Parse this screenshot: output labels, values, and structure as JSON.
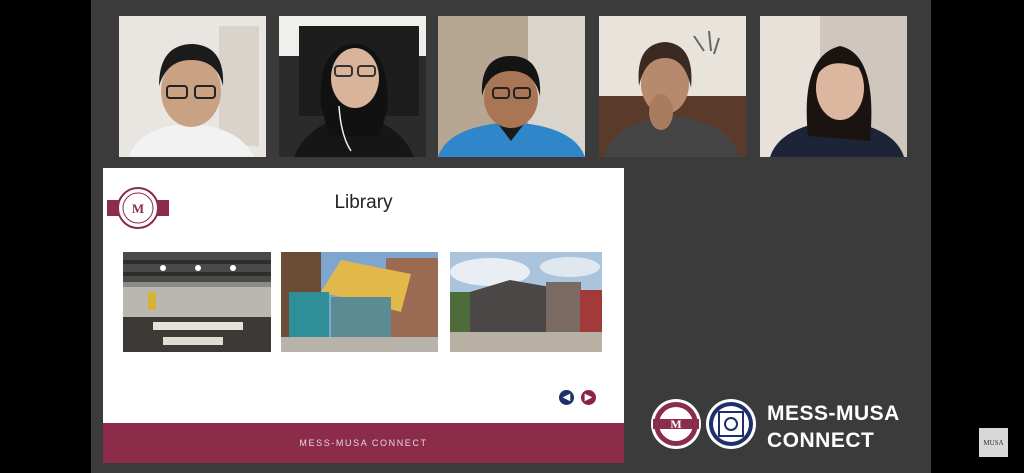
{
  "participants": [
    {
      "name": "",
      "colors": {
        "bg": "#e9e6e1",
        "skin": "#c9a183",
        "hair": "#1b1b1b",
        "shirt": "#f2f2f2"
      }
    },
    {
      "name": "",
      "colors": {
        "bg": "#2b2b2b",
        "skin": "#d9b39a",
        "hair": "#111111",
        "shirt": "#161616"
      }
    },
    {
      "name": "",
      "colors": {
        "bg": "#b6a692",
        "skin": "#a87555",
        "hair": "#141414",
        "shirt": "#2f86c9"
      }
    },
    {
      "name": "",
      "colors": {
        "bg": "#e8e4dc",
        "skin": "#b78a6d",
        "hair": "#3a2a21",
        "shirt": "#454545"
      }
    },
    {
      "name": "",
      "colors": {
        "bg": "#cfc6bd",
        "skin": "#dcb7a0",
        "hair": "#1a1410",
        "shirt": "#1d2438"
      }
    }
  ],
  "slide": {
    "title": "Library",
    "footer_text": "MESS-MUSA CONNECT",
    "photos": [
      "library-interior",
      "library-entrance",
      "library-building"
    ],
    "nav": {
      "prev_icon": "chevron-left-icon",
      "next_icon": "chevron-right-icon"
    }
  },
  "brand": {
    "line1": "MESS-MUSA",
    "line2": "CONNECT",
    "logo1_icon": "mess-seal-logo",
    "logo2_icon": "msa-seal-logo"
  },
  "watermark": {
    "text": "MUSA"
  },
  "colors": {
    "stage": "#3b3b3b",
    "accent_maroon": "#8b2c4b",
    "accent_navy": "#1f2f6b"
  }
}
